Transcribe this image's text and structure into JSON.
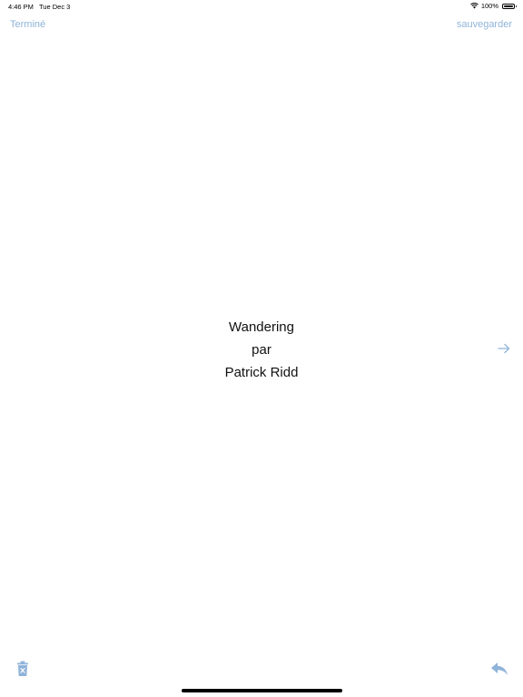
{
  "status_bar": {
    "time": "4:46 PM",
    "date": "Tue Dec 3",
    "battery": "100%"
  },
  "nav": {
    "done_label": "Terminé",
    "save_label": "sauvegarder"
  },
  "content": {
    "title": "Wandering",
    "by": "par",
    "author": "Patrick Ridd"
  },
  "icons": {
    "wifi": "wifi-icon",
    "battery": "battery-icon",
    "next": "arrow-right-icon",
    "trash": "trash-icon",
    "reply": "reply-icon"
  },
  "colors": {
    "accent": "#8fb3d9",
    "text": "#111111",
    "background": "#ffffff"
  }
}
